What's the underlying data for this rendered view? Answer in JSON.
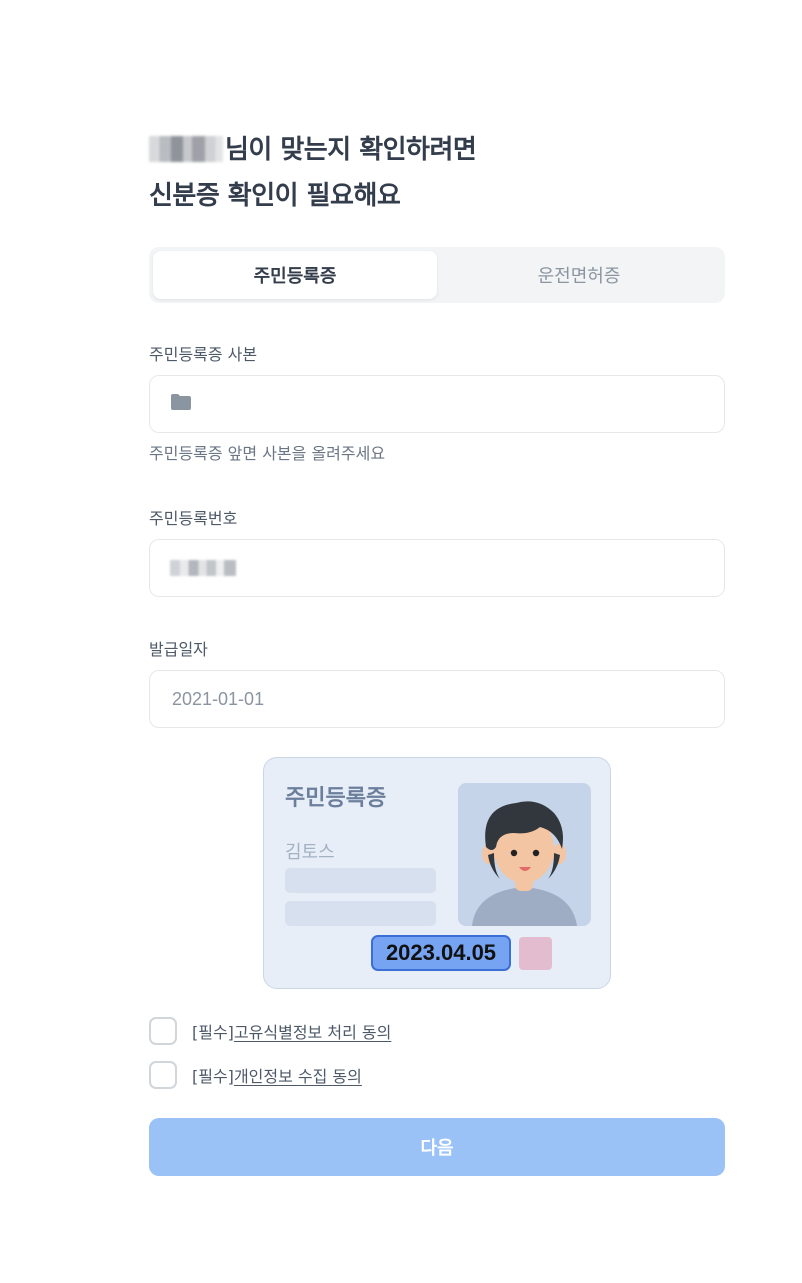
{
  "header": {
    "title_line1_suffix": "님이 맞는지 확인하려면",
    "title_line2": "신분증 확인이 필요해요"
  },
  "tabs": [
    {
      "label": "주민등록증",
      "active": true
    },
    {
      "label": "운전면허증",
      "active": false
    }
  ],
  "upload": {
    "label": "주민등록증 사본",
    "icon": "folder-icon",
    "helper": "주민등록증 앞면 사본을 올려주세요"
  },
  "resident_number": {
    "label": "주민등록번호",
    "value": ""
  },
  "issue_date": {
    "label": "발급일자",
    "placeholder": "2021-01-01"
  },
  "id_card_illustration": {
    "title": "주민등록증",
    "name": "김토스",
    "date": "2023.04.05"
  },
  "agreements": [
    {
      "prefix": "[필수]",
      "link": "고유식별정보 처리 동의",
      "checked": false
    },
    {
      "prefix": "[필수]",
      "link": "개인정보 수집 동의",
      "checked": false
    }
  ],
  "next_button": {
    "label": "다음",
    "enabled": false
  },
  "colors": {
    "primary_disabled": "#9bc2f7",
    "text_main": "#333d4b",
    "highlight_date": "#76a4f3"
  }
}
